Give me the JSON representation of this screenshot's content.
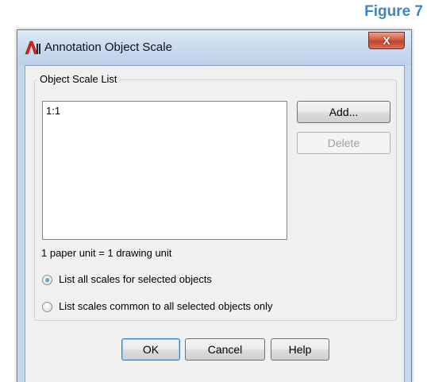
{
  "figure_label": "Figure 7",
  "window": {
    "title": "Annotation Object Scale",
    "close_glyph": "X",
    "icon": "autocad-app-icon"
  },
  "group": {
    "legend": "Object Scale List",
    "scales": [
      "1:1"
    ],
    "add_label": "Add...",
    "delete_label": "Delete",
    "unit_info": "1 paper unit = 1 drawing unit"
  },
  "radios": [
    {
      "label": "List all scales for selected objects",
      "checked": true
    },
    {
      "label": "List scales common to all selected objects only",
      "checked": false
    }
  ],
  "footer": {
    "ok_label": "OK",
    "cancel_label": "Cancel",
    "help_label": "Help"
  },
  "colors": {
    "figure_label": "#3c85c6",
    "close_button": "#c2422a"
  }
}
